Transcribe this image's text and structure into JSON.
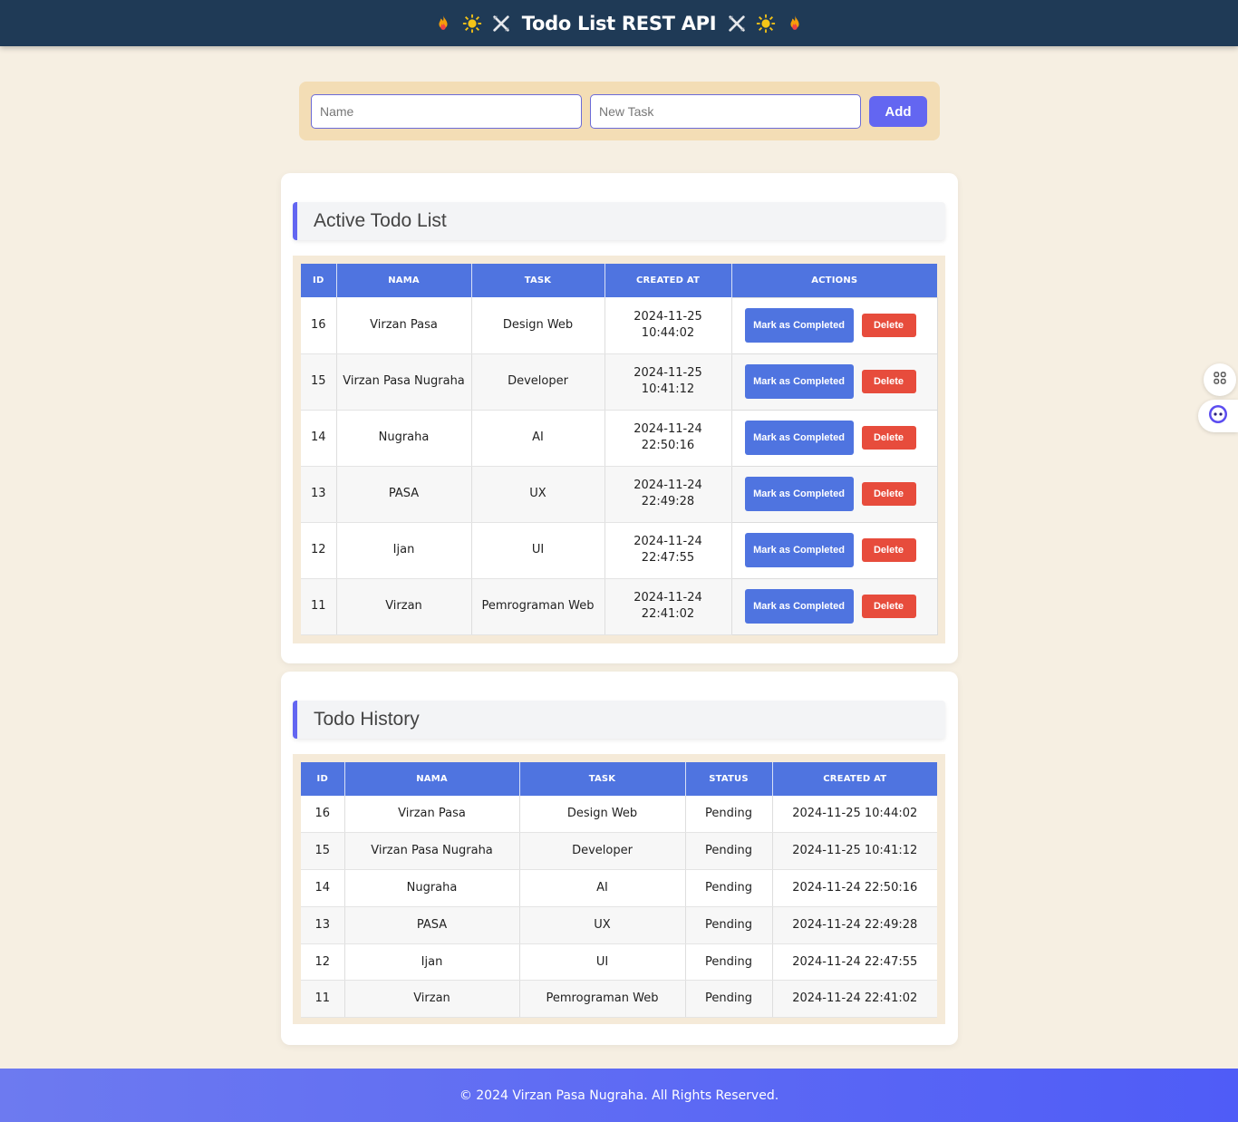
{
  "header": {
    "title": "Todo List REST API"
  },
  "form": {
    "name_placeholder": "Name",
    "task_placeholder": "New Task",
    "add_label": "Add"
  },
  "active": {
    "title": "Active Todo List",
    "columns": [
      "ID",
      "NAMA",
      "TASK",
      "CREATED AT",
      "ACTIONS"
    ],
    "mark_label": "Mark as Completed",
    "delete_label": "Delete",
    "rows": [
      {
        "id": "16",
        "nama": "Virzan Pasa",
        "task": "Design Web",
        "created_at": "2024-11-25 10:44:02"
      },
      {
        "id": "15",
        "nama": "Virzan Pasa Nugraha",
        "task": "Developer",
        "created_at": "2024-11-25 10:41:12"
      },
      {
        "id": "14",
        "nama": "Nugraha",
        "task": "AI",
        "created_at": "2024-11-24 22:50:16"
      },
      {
        "id": "13",
        "nama": "PASA",
        "task": "UX",
        "created_at": "2024-11-24 22:49:28"
      },
      {
        "id": "12",
        "nama": "Ijan",
        "task": "UI",
        "created_at": "2024-11-24 22:47:55"
      },
      {
        "id": "11",
        "nama": "Virzan",
        "task": "Pemrograman Web",
        "created_at": "2024-11-24 22:41:02"
      }
    ]
  },
  "history": {
    "title": "Todo History",
    "columns": [
      "ID",
      "NAMA",
      "TASK",
      "STATUS",
      "CREATED AT"
    ],
    "rows": [
      {
        "id": "16",
        "nama": "Virzan Pasa",
        "task": "Design Web",
        "status": "Pending",
        "created_at": "2024-11-25 10:44:02"
      },
      {
        "id": "15",
        "nama": "Virzan Pasa Nugraha",
        "task": "Developer",
        "status": "Pending",
        "created_at": "2024-11-25 10:41:12"
      },
      {
        "id": "14",
        "nama": "Nugraha",
        "task": "AI",
        "status": "Pending",
        "created_at": "2024-11-24 22:50:16"
      },
      {
        "id": "13",
        "nama": "PASA",
        "task": "UX",
        "status": "Pending",
        "created_at": "2024-11-24 22:49:28"
      },
      {
        "id": "12",
        "nama": "Ijan",
        "task": "UI",
        "status": "Pending",
        "created_at": "2024-11-24 22:47:55"
      },
      {
        "id": "11",
        "nama": "Virzan",
        "task": "Pemrograman Web",
        "status": "Pending",
        "created_at": "2024-11-24 22:41:02"
      }
    ]
  },
  "footer": {
    "text": "© 2024 Virzan Pasa Nugraha. All Rights Reserved."
  },
  "icons": [
    "fire-icon",
    "sun-icon",
    "tools-icon",
    "apps-icon",
    "assistant-icon"
  ],
  "colors": {
    "header_bg": "#1f3a56",
    "accent": "#6366f1",
    "table_header": "#4f74e0",
    "delete": "#e74c3c",
    "page_bg": "#f6efe2"
  }
}
